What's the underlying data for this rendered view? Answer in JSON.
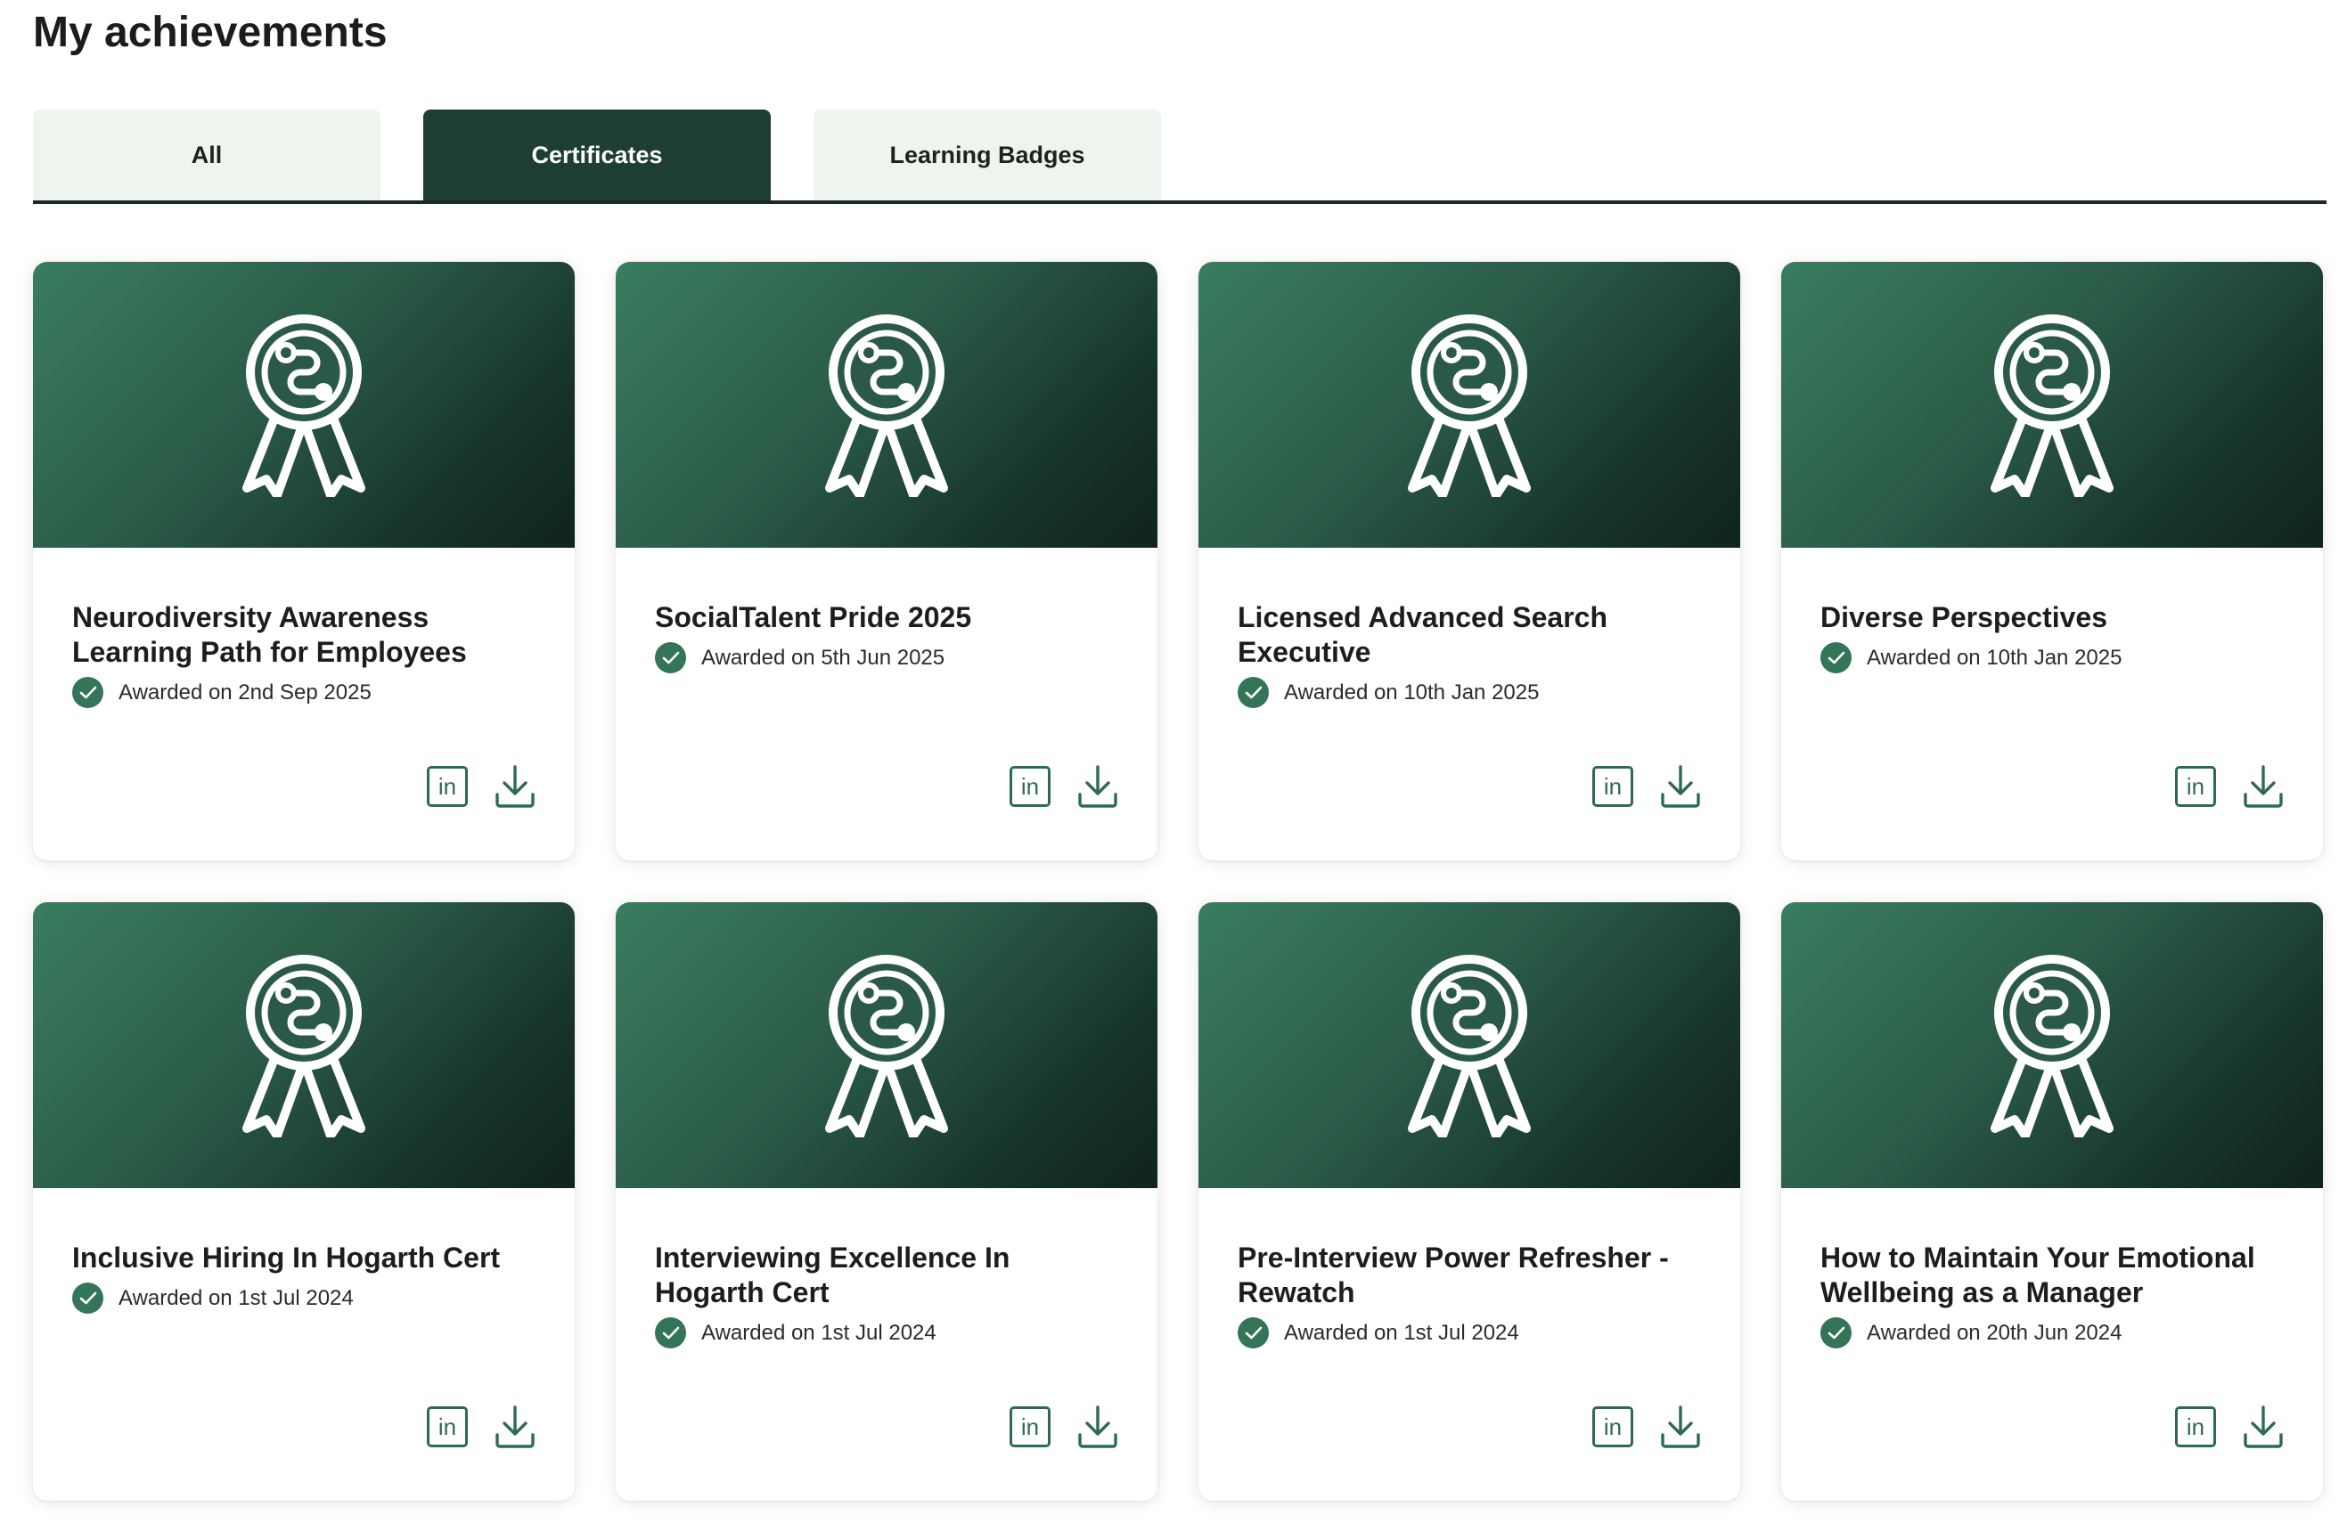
{
  "page_title": "My achievements",
  "tabs": [
    {
      "label": "All",
      "active": false
    },
    {
      "label": "Certificates",
      "active": true
    },
    {
      "label": "Learning Badges",
      "active": false
    }
  ],
  "icons": {
    "banner": "award-ribbon-icon",
    "awarded": "check-circle-icon",
    "share": "linkedin-icon",
    "download": "download-icon"
  },
  "colors": {
    "accent_dark": "#1e3d35",
    "accent_green": "#347458",
    "tab_bg": "#eef5ee"
  },
  "certificates": [
    {
      "title": "Neurodiversity Awareness Learning Path for Employees",
      "awarded": "Awarded on 2nd Sep 2025",
      "linkedin_label": "in"
    },
    {
      "title": "SocialTalent Pride 2025",
      "awarded": "Awarded on 5th Jun 2025",
      "linkedin_label": "in"
    },
    {
      "title": "Licensed Advanced Search Executive",
      "awarded": "Awarded on 10th Jan 2025",
      "linkedin_label": "in"
    },
    {
      "title": "Diverse Perspectives",
      "awarded": "Awarded on 10th Jan 2025",
      "linkedin_label": "in"
    },
    {
      "title": "Inclusive Hiring In Hogarth Cert",
      "awarded": "Awarded on 1st Jul 2024",
      "linkedin_label": "in"
    },
    {
      "title": "Interviewing Excellence In Hogarth Cert",
      "awarded": "Awarded on 1st Jul 2024",
      "linkedin_label": "in"
    },
    {
      "title": "Pre-Interview Power Refresher - Rewatch",
      "awarded": "Awarded on 1st Jul 2024",
      "linkedin_label": "in"
    },
    {
      "title": "How to Maintain Your Emotional Wellbeing as a Manager",
      "awarded": "Awarded on 20th Jun 2024",
      "linkedin_label": "in"
    }
  ]
}
